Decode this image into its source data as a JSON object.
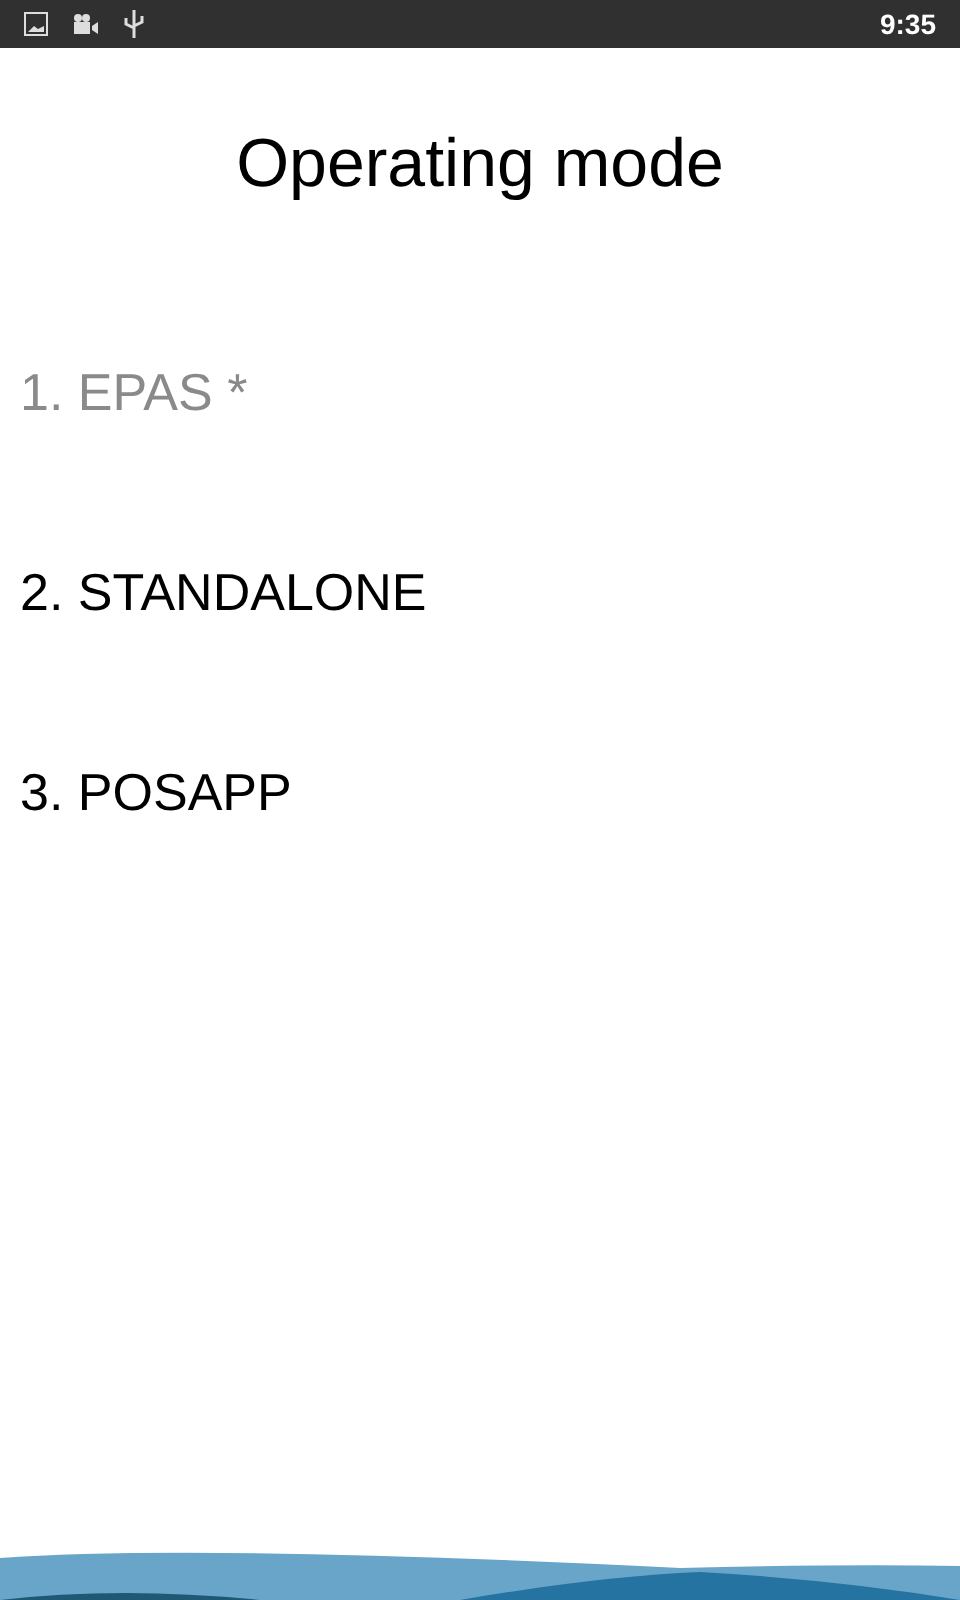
{
  "status_bar": {
    "time": "9:35"
  },
  "title": "Operating mode",
  "options": [
    {
      "label": "1. EPAS *",
      "disabled": true
    },
    {
      "label": "2. STANDALONE",
      "disabled": false
    },
    {
      "label": "3. POSAPP",
      "disabled": false
    }
  ]
}
